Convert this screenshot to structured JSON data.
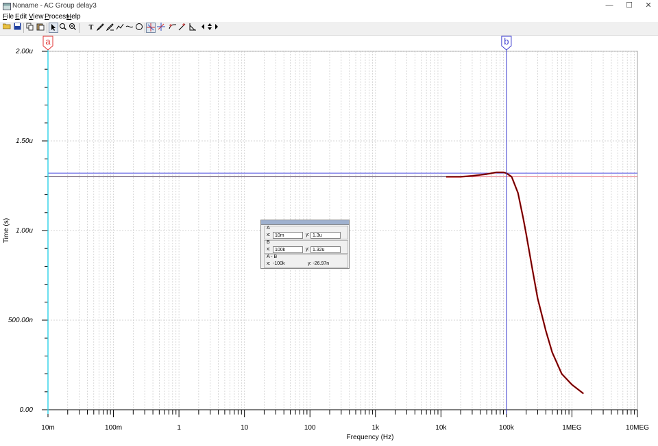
{
  "window": {
    "title": "Noname - AC Group delay3",
    "minimize_glyph": "—",
    "maximize_glyph": "☐",
    "close_glyph": "✕"
  },
  "menu": [
    {
      "label": "File"
    },
    {
      "label": "Edit"
    },
    {
      "label": "View"
    },
    {
      "label": "Process"
    },
    {
      "label": "Help"
    }
  ],
  "toolbar": {
    "icons": [
      "open-folder-icon",
      "save-icon",
      "copy-icon",
      "paste-icon",
      "pointer-icon",
      "zoom-in-icon",
      "zoom-out-icon",
      "text-icon",
      "pen-icon",
      "pen-edit-icon",
      "graph-icon",
      "line-icon",
      "circle-icon",
      "cursor-a-icon",
      "cursor-b-icon",
      "cursor-move-icon",
      "cursor-add-icon",
      "slope-icon",
      "peak-icon",
      "left-arrow-icon",
      "up-down-icon",
      "right-arrow-icon"
    ]
  },
  "colors": {
    "grid": "#c8c8c8",
    "curve": "#5a0000",
    "curve_overlay": "#cc2222",
    "cursor_a": "#2ad1e8",
    "cursor_b": "#3a3ad0",
    "cursor_a_label": "#e03030",
    "cursor_b_label": "#3a3ad0",
    "horiz_a": "#e06070",
    "horiz_b": "#4a4ae0"
  },
  "cursors": {
    "a_label": "a",
    "b_label": "b",
    "a_x": 0.01,
    "b_x": 100000,
    "a_y": 1.3,
    "b_y": 1.32
  },
  "readout": {
    "a_header": "A",
    "b_header": "B",
    "diff_header": "A - B",
    "x_label": "x:",
    "y_label": "y:",
    "a_x": "10m",
    "a_y": "1.3u",
    "b_x": "100k",
    "b_y": "1.32u",
    "diff_x": "-100k",
    "diff_y": "y: -26.97n"
  },
  "chart_data": {
    "type": "line",
    "xlabel": "Frequency (Hz)",
    "ylabel": "Time (s)",
    "xscale": "log",
    "xlim": [
      0.01,
      10000000
    ],
    "ylim": [
      0,
      2
    ],
    "x_ticks": [
      {
        "value": 0.01,
        "label": "10m"
      },
      {
        "value": 0.1,
        "label": "100m"
      },
      {
        "value": 1,
        "label": "1"
      },
      {
        "value": 10,
        "label": "10"
      },
      {
        "value": 100,
        "label": "100"
      },
      {
        "value": 1000,
        "label": "1k"
      },
      {
        "value": 10000,
        "label": "10k"
      },
      {
        "value": 100000,
        "label": "100k"
      },
      {
        "value": 1000000,
        "label": "1MEG"
      },
      {
        "value": 10000000,
        "label": "10MEG"
      }
    ],
    "y_ticks": [
      {
        "value": 0,
        "label": "0.00"
      },
      {
        "value": 0.5,
        "label": "500.00n"
      },
      {
        "value": 1,
        "label": "1.00u"
      },
      {
        "value": 1.5,
        "label": "1.50u"
      },
      {
        "value": 2,
        "label": "2.00u"
      }
    ],
    "grid": true,
    "series": [
      {
        "x": [
          12000,
          20000,
          30000,
          50000,
          70000,
          90000,
          100000,
          120000,
          150000,
          180000,
          200000,
          250000,
          300000,
          400000,
          500000,
          700000,
          1000000,
          1500000
        ],
        "y": [
          1.3,
          1.3,
          1.305,
          1.315,
          1.325,
          1.325,
          1.32,
          1.3,
          1.21,
          1.07,
          0.98,
          0.78,
          0.62,
          0.44,
          0.32,
          0.2,
          0.14,
          0.09
        ]
      }
    ]
  }
}
